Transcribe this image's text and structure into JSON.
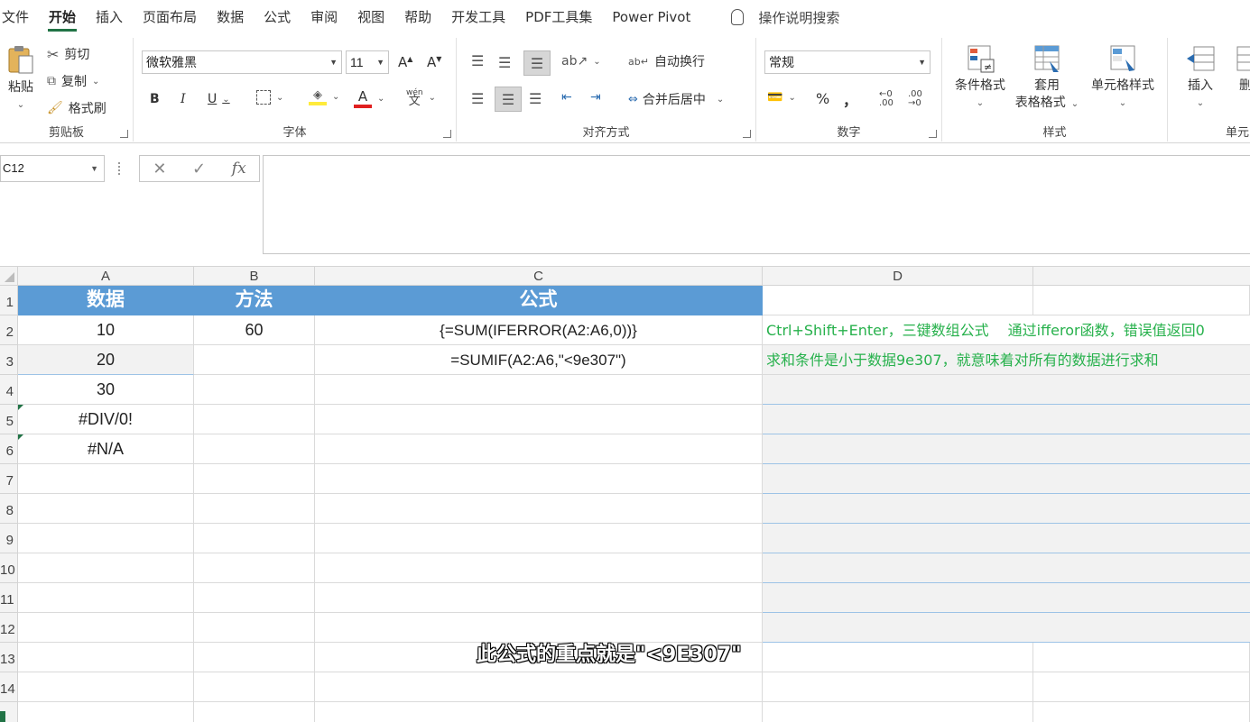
{
  "menu": {
    "tabs": [
      "文件",
      "开始",
      "插入",
      "页面布局",
      "数据",
      "公式",
      "审阅",
      "视图",
      "帮助",
      "开发工具",
      "PDF工具集",
      "Power Pivot"
    ],
    "active": "开始",
    "tell_me": "操作说明搜索"
  },
  "ribbon": {
    "clipboard": {
      "paste": "粘贴",
      "cut": "剪切",
      "copy": "复制",
      "format_painter": "格式刷",
      "label": "剪贴板"
    },
    "font": {
      "name": "微软雅黑",
      "size": "11",
      "bold": "B",
      "italic": "I",
      "underline": "U",
      "phonetic": "wén",
      "label": "字体"
    },
    "alignment": {
      "wrap_text": "自动换行",
      "merge_center": "合并后居中",
      "label": "对齐方式"
    },
    "number": {
      "format": "常规",
      "percent": "%",
      "comma": "，",
      "label": "数字"
    },
    "styles": {
      "conditional": "条件格式",
      "table_format_1": "套用",
      "table_format_2": "表格格式",
      "cell_styles": "单元格样式",
      "label": "样式"
    },
    "cells": {
      "insert": "插入",
      "delete": "删",
      "label": "单元"
    }
  },
  "formula_bar": {
    "name_box": "C12",
    "cancel": "✕",
    "enter": "✓",
    "fx": "fx",
    "content": ""
  },
  "columns": [
    "A",
    "B",
    "C",
    "D"
  ],
  "rows": [
    "1",
    "2",
    "3",
    "4",
    "5",
    "6",
    "7",
    "8",
    "9",
    "10",
    "11",
    "12",
    "13",
    "14"
  ],
  "cells": {
    "A1": "数据",
    "B1": "方法",
    "C1": "公式",
    "A2": "10",
    "B2": "60",
    "C2": "{=SUM(IFERROR(A2:A6,0))}",
    "D2": "Ctrl+Shift+Enter，三键数组公式　  通过ifferor函数，错误值返回0",
    "A3": "20",
    "C3": "=SUMIF(A2:A6,\"<9e307\")",
    "D3": "求和条件是小于数据9e307，就意味着对所有的数据进行求和",
    "A4": "30",
    "A5": "#DIV/0!",
    "A6": "#N/A"
  },
  "caption": "此公式的重点就是\"<9E307\"",
  "colors": {
    "header_fill": "#5b9bd5",
    "note_text": "#27b14c",
    "excel_green": "#217346"
  }
}
